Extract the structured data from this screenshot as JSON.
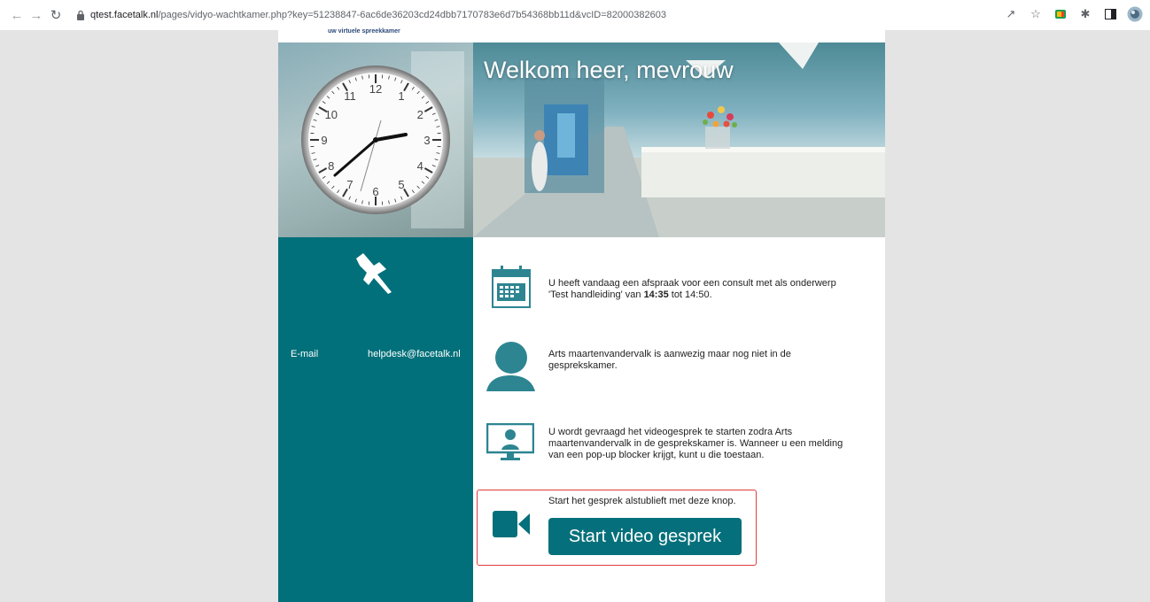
{
  "browser": {
    "url_host": "qtest.facetalk.nl",
    "url_path": "/pages/vidyo-wachtkamer.php?key=51238847-6ac6de36203cd24dbb7170783e6d7b54368bb11d&vcID=82000382603"
  },
  "header": {
    "logo_tagline": "uw virtuele spreekkamer",
    "welcome": "Welkom heer, mevrouw"
  },
  "contact": {
    "email_label": "E-mail",
    "email_value": "helpdesk@facetalk.nl"
  },
  "appointment": {
    "text_before": "U heeft vandaag een afspraak voor een consult met als onderwerp 'Test handleiding' van ",
    "start_time": "14:35",
    "text_middle": " tot ",
    "end_time": "14:50",
    "text_after": "."
  },
  "doctor_status": "Arts maartenvandervalk is aanwezig maar nog niet in de gesprekskamer.",
  "instructions": "U wordt gevraagd het videogesprek te starten zodra Arts maartenvandervalk in de gesprekskamer is. Wanneer u een melding van een pop-up blocker krijgt, kunt u die toestaan.",
  "start": {
    "prompt": "Start het gesprek alstublieft met deze knop.",
    "button_label": "Start video gesprek"
  },
  "colors": {
    "brand_teal": "#02707a",
    "highlight_red": "#e23b3b"
  },
  "clock": {
    "numbers": [
      "12",
      "1",
      "2",
      "3",
      "4",
      "5",
      "6",
      "7",
      "8",
      "9",
      "10",
      "11"
    ]
  }
}
